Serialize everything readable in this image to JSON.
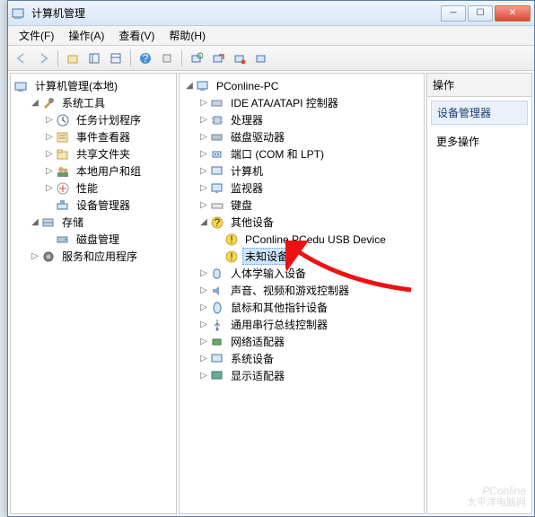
{
  "titlebar": {
    "title": "计算机管理"
  },
  "menu": {
    "file": "文件(F)",
    "action": "操作(A)",
    "view": "查看(V)",
    "help": "帮助(H)"
  },
  "left_tree": {
    "root": "计算机管理(本地)",
    "sys_tools": "系统工具",
    "task_sched": "任务计划程序",
    "event_viewer": "事件查看器",
    "shared": "共享文件夹",
    "users": "本地用户和组",
    "perf": "性能",
    "dev_mgr": "设备管理器",
    "storage": "存储",
    "disk_mgmt": "磁盘管理",
    "services": "服务和应用程序"
  },
  "mid_tree": {
    "root": "PConline-PC",
    "ide": "IDE ATA/ATAPI 控制器",
    "cpu": "处理器",
    "disk": "磁盘驱动器",
    "port": "端口 (COM 和 LPT)",
    "computer": "计算机",
    "monitor": "监视器",
    "keyboard": "键盘",
    "other": "其他设备",
    "pcedu": "PConline PCedu USB Device",
    "unknown": "未知设备",
    "hid": "人体学输入设备",
    "sound": "声音、视频和游戏控制器",
    "mouse": "鼠标和其他指针设备",
    "usb": "通用串行总线控制器",
    "network": "网络适配器",
    "sysdev": "系统设备",
    "display": "显示适配器"
  },
  "right": {
    "header": "操作",
    "section": "设备管理器",
    "more": "更多操作"
  },
  "watermark": {
    "en": "PConline",
    "cn": "太平洋电脑网"
  }
}
